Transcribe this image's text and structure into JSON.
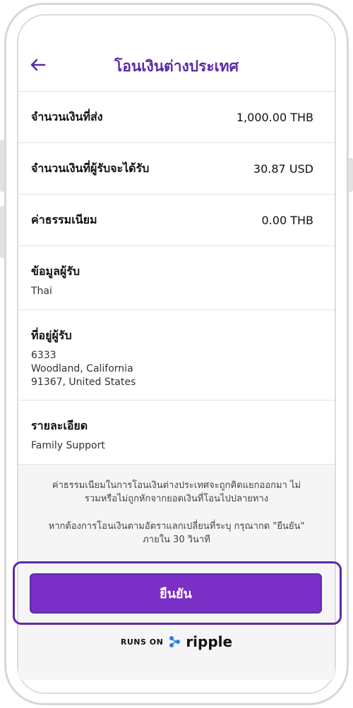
{
  "header": {
    "title": "โอนเงินต่างประเทศ"
  },
  "summary": [
    {
      "label": "จำนวนเงินที่ส่ง",
      "value": "1,000.00 THB"
    },
    {
      "label": "จำนวนเงินที่ผู้รับจะได้รับ",
      "value": "30.87 USD"
    },
    {
      "label": "ค่าธรรมเนียม",
      "value": "0.00 THB"
    }
  ],
  "recipient": {
    "label": "ข้อมูลผู้รับ",
    "value": "Thai"
  },
  "address": {
    "label": "ที่อยู่ผู้รับ",
    "lines": [
      "6333",
      "Woodland, California",
      "91367, United States"
    ]
  },
  "details": {
    "label": "รายละเอียด",
    "value": "Family Support"
  },
  "notes": {
    "fee_note_line1": "ค่าธรรมเนียมในการโอนเงินต่างประเทศจะถูกคิดแยกออกมา ไม่",
    "fee_note_line2": "รวมหรือไม่ถูกหักจากยอดเงินที่โอนไปปลายทาง",
    "rate_note_line1": "หากต้องการโอนเงินตามอัตราแลกเปลี่ยนที่ระบุ กรุณากด \"ยืนยัน\"",
    "rate_note_line2": "ภายใน 30 วินาที"
  },
  "confirm_label": "ยืนยัน",
  "footer": {
    "runs_on": "RUNS ON",
    "brand": "ripple"
  },
  "colors": {
    "accent": "#5a2ca6",
    "button": "#7a2fc6"
  },
  "icons": {
    "back": "arrow-left-icon",
    "brand": "ripple-logo-icon"
  }
}
